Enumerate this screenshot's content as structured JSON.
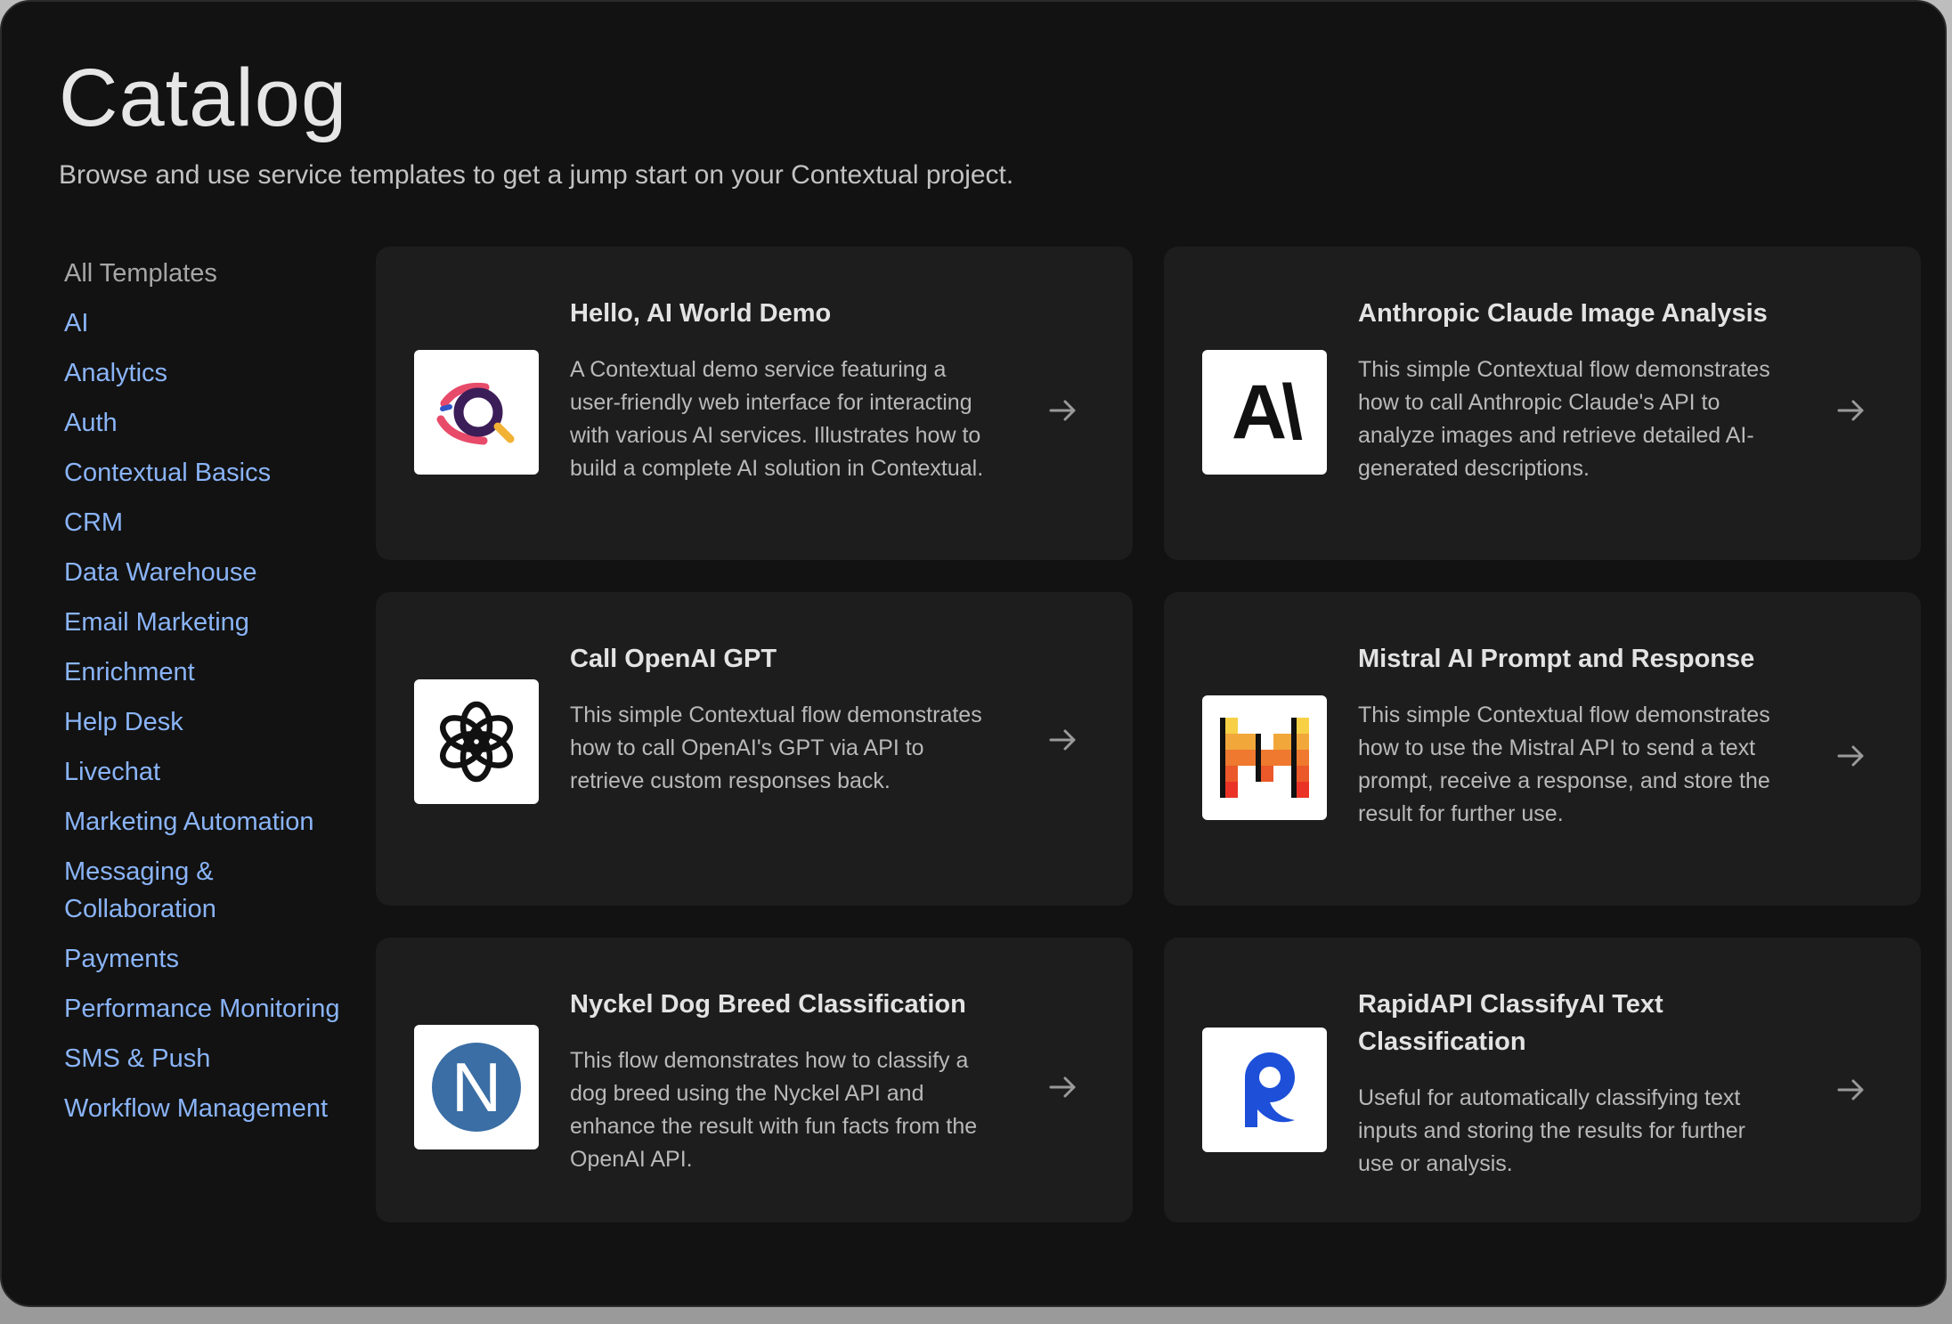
{
  "header": {
    "title": "Catalog",
    "subtitle": "Browse and use service templates to get a jump start on your Contextual project."
  },
  "sidebar": {
    "items": [
      {
        "label": "All Templates"
      },
      {
        "label": "AI"
      },
      {
        "label": "Analytics"
      },
      {
        "label": "Auth"
      },
      {
        "label": "Contextual Basics"
      },
      {
        "label": "CRM"
      },
      {
        "label": "Data Warehouse"
      },
      {
        "label": "Email Marketing"
      },
      {
        "label": "Enrichment"
      },
      {
        "label": "Help Desk"
      },
      {
        "label": "Livechat"
      },
      {
        "label": "Marketing Automation"
      },
      {
        "label": "Messaging & Collaboration"
      },
      {
        "label": "Payments"
      },
      {
        "label": "Performance Monitoring"
      },
      {
        "label": "SMS & Push"
      },
      {
        "label": "Workflow Management"
      }
    ]
  },
  "cards": [
    {
      "title": "Hello, AI World Demo",
      "description": "A Contextual demo service featuring a user-friendly web interface for interacting with various AI services. Illustrates how to build a complete AI solution in Contextual.",
      "icon": "contextual-logo-icon"
    },
    {
      "title": "Anthropic Claude Image Analysis",
      "description": "This simple Contextual flow demonstrates how to call Anthropic Claude's API to analyze images and retrieve detailed AI-generated descriptions.",
      "icon": "anthropic-logo-icon",
      "logo_text": "A\\"
    },
    {
      "title": "Call OpenAI GPT",
      "description": "This simple Contextual flow demonstrates how to call OpenAI's GPT via API to retrieve custom responses back.",
      "icon": "openai-logo-icon"
    },
    {
      "title": "Mistral AI Prompt and Response",
      "description": "This simple Contextual flow demonstrates how to use the Mistral API to send a text prompt, receive a response, and store the result for further use.",
      "icon": "mistral-logo-icon"
    },
    {
      "title": "Nyckel Dog Breed Classification",
      "description": "This flow demonstrates how to classify a dog breed using the Nyckel API and enhance the result with fun facts from the OpenAI API.",
      "icon": "nyckel-logo-icon",
      "logo_text": "N"
    },
    {
      "title": "RapidAPI ClassifyAI Text Classification",
      "description": "Useful for automatically classifying text inputs and storing the results for further use or analysis.",
      "icon": "rapidapi-logo-icon"
    }
  ],
  "colors": {
    "background": "#121212",
    "card": "#1d1d1d",
    "link": "#8ab4f8",
    "nyckel_blue": "#3a6ea5",
    "rapidapi_blue": "#1d4fd8"
  }
}
